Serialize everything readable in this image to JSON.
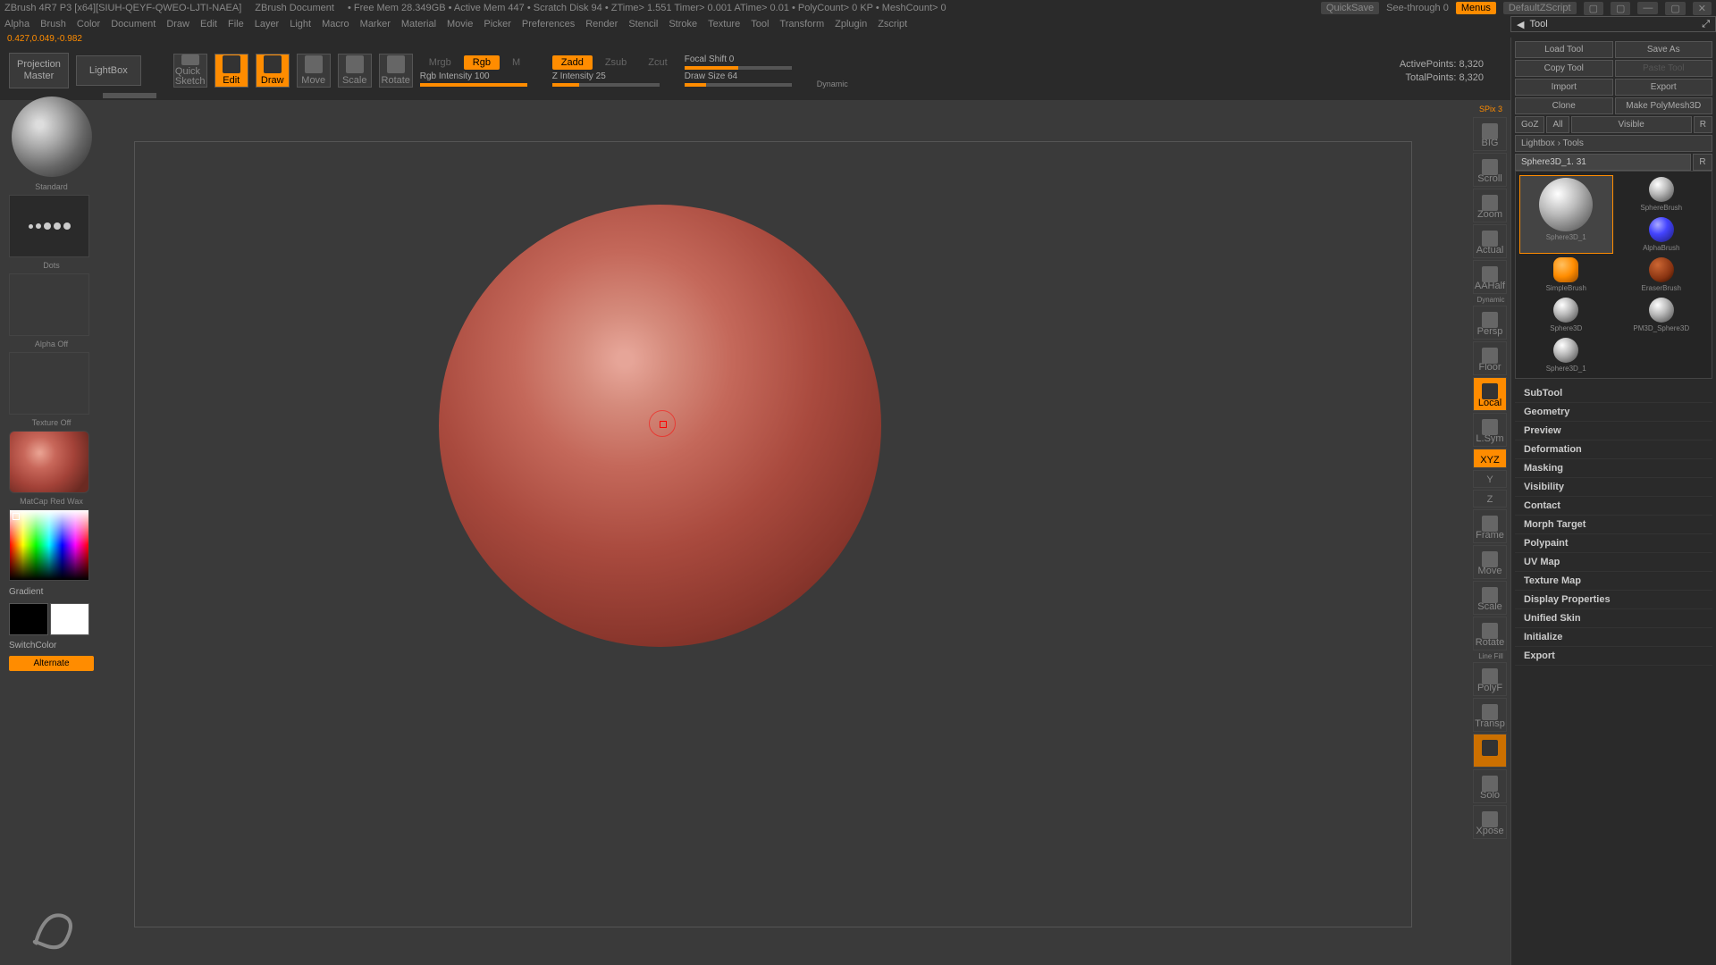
{
  "titlebar": {
    "app": "ZBrush 4R7 P3 [x64][SIUH-QEYF-QWEO-LJTI-NAEA]",
    "doc": "ZBrush Document",
    "stats": "• Free Mem 28.349GB • Active Mem 447 • Scratch Disk 94 • ZTime> 1.551 Timer> 0.001 ATime> 0.01 • PolyCount> 0 KP • MeshCount> 0",
    "quicksave": "QuickSave",
    "seethrough": "See-through  0",
    "menus": "Menus",
    "script": "DefaultZScript"
  },
  "menubar": [
    "Alpha",
    "Brush",
    "Color",
    "Document",
    "Draw",
    "Edit",
    "File",
    "Layer",
    "Light",
    "Macro",
    "Marker",
    "Material",
    "Movie",
    "Picker",
    "Preferences",
    "Render",
    "Stencil",
    "Stroke",
    "Texture",
    "Tool",
    "Transform",
    "Zplugin",
    "Zscript"
  ],
  "coords": "0.427,0.049,-0.982",
  "toolHeader": "Tool",
  "toolbar": {
    "projMaster": "Projection\nMaster",
    "lightbox": "LightBox",
    "quickSketch": "Quick\nSketch",
    "edit": "Edit",
    "draw": "Draw",
    "move": "Move",
    "scale": "Scale",
    "rotate": "Rotate",
    "mrgb": "Mrgb",
    "rgb": "Rgb",
    "m": "M",
    "rgbIntensity": "Rgb Intensity 100",
    "zadd": "Zadd",
    "zsub": "Zsub",
    "zcut": "Zcut",
    "zIntensity": "Z Intensity 25",
    "focalShift": "Focal Shift 0",
    "drawSize": "Draw Size 64",
    "dynamic": "Dynamic",
    "activePoints": "ActivePoints: 8,320",
    "totalPoints": "TotalPoints: 8,320"
  },
  "leftbar": {
    "brushName": "Standard",
    "strokeName": "Dots",
    "alphaOff": "Alpha Off",
    "textureOff": "Texture Off",
    "materialName": "MatCap Red Wax",
    "gradient": "Gradient",
    "switchColor": "SwitchColor",
    "alternate": "Alternate"
  },
  "rightV": {
    "spix": "SPix 3",
    "items": [
      "BIG",
      "Scroll",
      "Zoom",
      "Actual",
      "AAHalf",
      "Persp",
      "Floor",
      "Local",
      "L.Sym",
      "XYZ",
      "",
      "",
      "Frame",
      "Move",
      "Scale",
      "Rotate",
      "PolyF",
      "Transp",
      "Solo",
      "Xpose"
    ],
    "dynamic": "Dynamic",
    "linefill": "Line Fill"
  },
  "rightPanel": {
    "loadTool": "Load Tool",
    "saveAs": "Save As",
    "copyTool": "Copy Tool",
    "pasteTool": "Paste Tool",
    "import": "Import",
    "export": "Export",
    "clone": "Clone",
    "makePolymesh": "Make PolyMesh3D",
    "goz": "GoZ",
    "all": "All",
    "visible": "Visible",
    "r": "R",
    "lightboxTools": "Lightbox › Tools",
    "toolName": "Sphere3D_1. 31",
    "tools": [
      {
        "name": "Sphere3D_1",
        "type": "light"
      },
      {
        "name": "SphereBrush",
        "type": "light-small"
      },
      {
        "name": "AlphaBrush",
        "type": "blue"
      },
      {
        "name": "SimpleBrush",
        "type": "orange"
      },
      {
        "name": "EraserBrush",
        "type": "dark-orange"
      },
      {
        "name": "Sphere3D",
        "type": "light"
      },
      {
        "name": "PM3D_Sphere3D",
        "type": "light"
      },
      {
        "name": "Sphere3D_1",
        "type": "light"
      }
    ],
    "accordion": [
      "SubTool",
      "Geometry",
      "Preview",
      "Deformation",
      "Masking",
      "Visibility",
      "Contact",
      "Morph Target",
      "Polypaint",
      "UV Map",
      "Texture Map",
      "Display Properties",
      "Unified Skin",
      "Initialize",
      "Export"
    ]
  }
}
